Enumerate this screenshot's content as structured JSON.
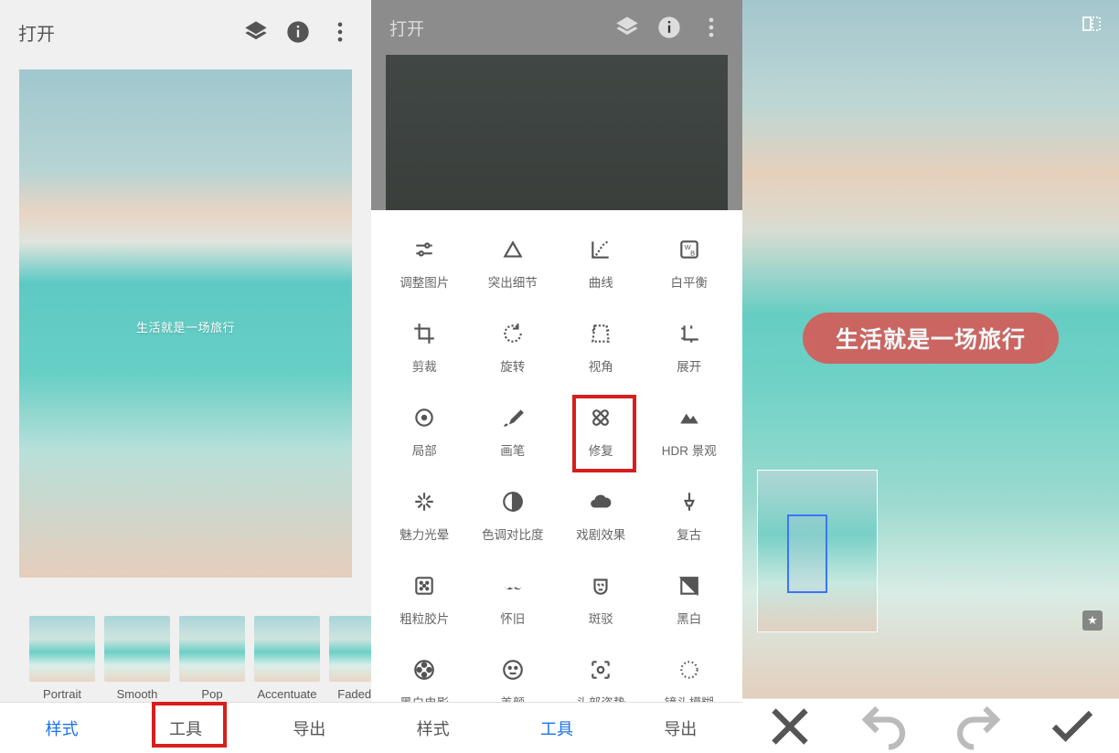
{
  "panel1": {
    "open_label": "打开",
    "image_overlay_text": "生活就是一场旅行",
    "filters": [
      {
        "label": "Portrait"
      },
      {
        "label": "Smooth"
      },
      {
        "label": "Pop"
      },
      {
        "label": "Accentuate"
      },
      {
        "label": "Faded Gl"
      }
    ],
    "tabs": {
      "styles": "样式",
      "tools": "工具",
      "export": "导出"
    }
  },
  "panel2": {
    "open_label": "打开",
    "tools": [
      {
        "label": "调整图片"
      },
      {
        "label": "突出细节"
      },
      {
        "label": "曲线"
      },
      {
        "label": "白平衡"
      },
      {
        "label": "剪裁"
      },
      {
        "label": "旋转"
      },
      {
        "label": "视角"
      },
      {
        "label": "展开"
      },
      {
        "label": "局部"
      },
      {
        "label": "画笔"
      },
      {
        "label": "修复"
      },
      {
        "label": "HDR 景观"
      },
      {
        "label": "魅力光晕"
      },
      {
        "label": "色调对比度"
      },
      {
        "label": "戏剧效果"
      },
      {
        "label": "复古"
      },
      {
        "label": "粗粒胶片"
      },
      {
        "label": "怀旧"
      },
      {
        "label": "斑驳"
      },
      {
        "label": "黑白"
      },
      {
        "label": "黑白电影"
      },
      {
        "label": "美颜"
      },
      {
        "label": "头部姿势"
      },
      {
        "label": "镜头模糊"
      }
    ],
    "tabs": {
      "styles": "样式",
      "tools": "工具",
      "export": "导出"
    }
  },
  "panel3": {
    "heal_text": "生活就是一场旅行"
  }
}
